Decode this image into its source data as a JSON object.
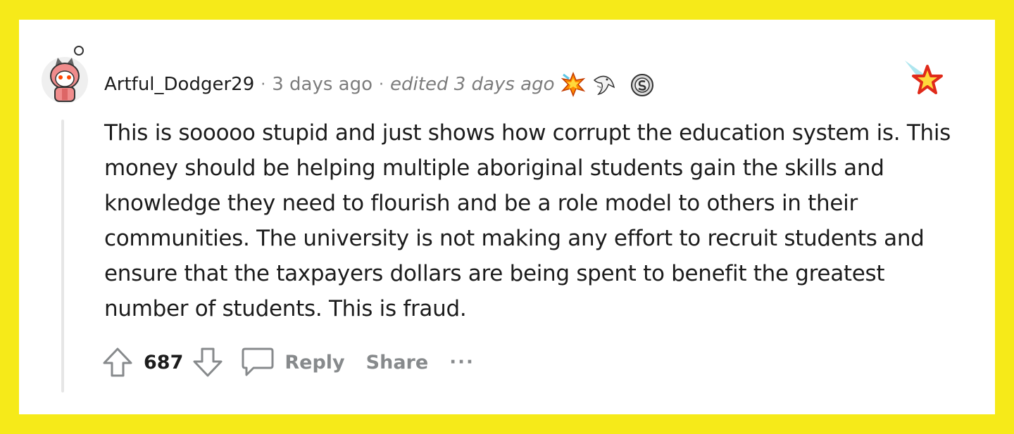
{
  "comment": {
    "username": "Artful_Dodger29",
    "time": "3 days ago",
    "edited": "edited 3 days ago",
    "separator": "·",
    "body": "This is sooooo stupid and just shows how corrupt the education system is. This money should be helping multiple aboriginal students gain the skills and knowledge they need to flourish and be a role model to others in their communities. The university is not making any effort to recruit students and ensure that the taxpayers dollars are being spent to benefit the greatest number of students. This is fraud.",
    "awards": [
      "starburst-award-icon",
      "bird-award-icon",
      "silver-coin-award-icon"
    ],
    "corner_icon": "star-icon"
  },
  "actions": {
    "upvote_icon": "upvote-arrow-icon",
    "vote_count": "687",
    "downvote_icon": "downvote-arrow-icon",
    "comment_icon": "speech-bubble-icon",
    "reply_label": "Reply",
    "share_label": "Share",
    "more_label": "···"
  },
  "colors": {
    "background": "#f6ea19",
    "card": "#ffffff",
    "text": "#1c1c1c",
    "muted": "#7c7c7c",
    "action": "#878a8c"
  }
}
